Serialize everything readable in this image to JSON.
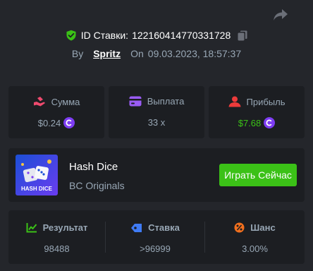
{
  "header": {
    "bet_id_label": "ID Ставки:",
    "bet_id": "122160414770331728",
    "by_label": "By",
    "username": "Spritz",
    "on_label": "On",
    "datetime": "09.03.2023, 18:57:37"
  },
  "stats": {
    "amount": {
      "label": "Сумма",
      "value": "$0.24",
      "icon": "hand-coins-icon",
      "currency_icon": "bc-coin-icon"
    },
    "payout": {
      "label": "Выплата",
      "value": "33 x",
      "icon": "wallet-card-icon"
    },
    "profit": {
      "label": "Прибыль",
      "value": "$7.68",
      "icon": "profit-user-icon",
      "currency_icon": "bc-coin-icon"
    }
  },
  "game": {
    "name": "Hash Dice",
    "provider": "BC Originals",
    "thumbnail_text": "HASH DICE",
    "play_label": "Играть Сейчас"
  },
  "result": {
    "columns": [
      {
        "label": "Результат",
        "value": "98488",
        "icon": "result-chart-icon"
      },
      {
        "label": "Ставка",
        "value": ">96999",
        "icon": "bet-tag-icon"
      },
      {
        "label": "Шанс",
        "value": "3.00%",
        "icon": "percent-icon"
      }
    ]
  },
  "colors": {
    "background": "#24262b",
    "panel": "#1c1e22",
    "accent_green": "#3bc117",
    "muted_text": "#98a7b5",
    "coin_purple": "#7d3cf3"
  }
}
